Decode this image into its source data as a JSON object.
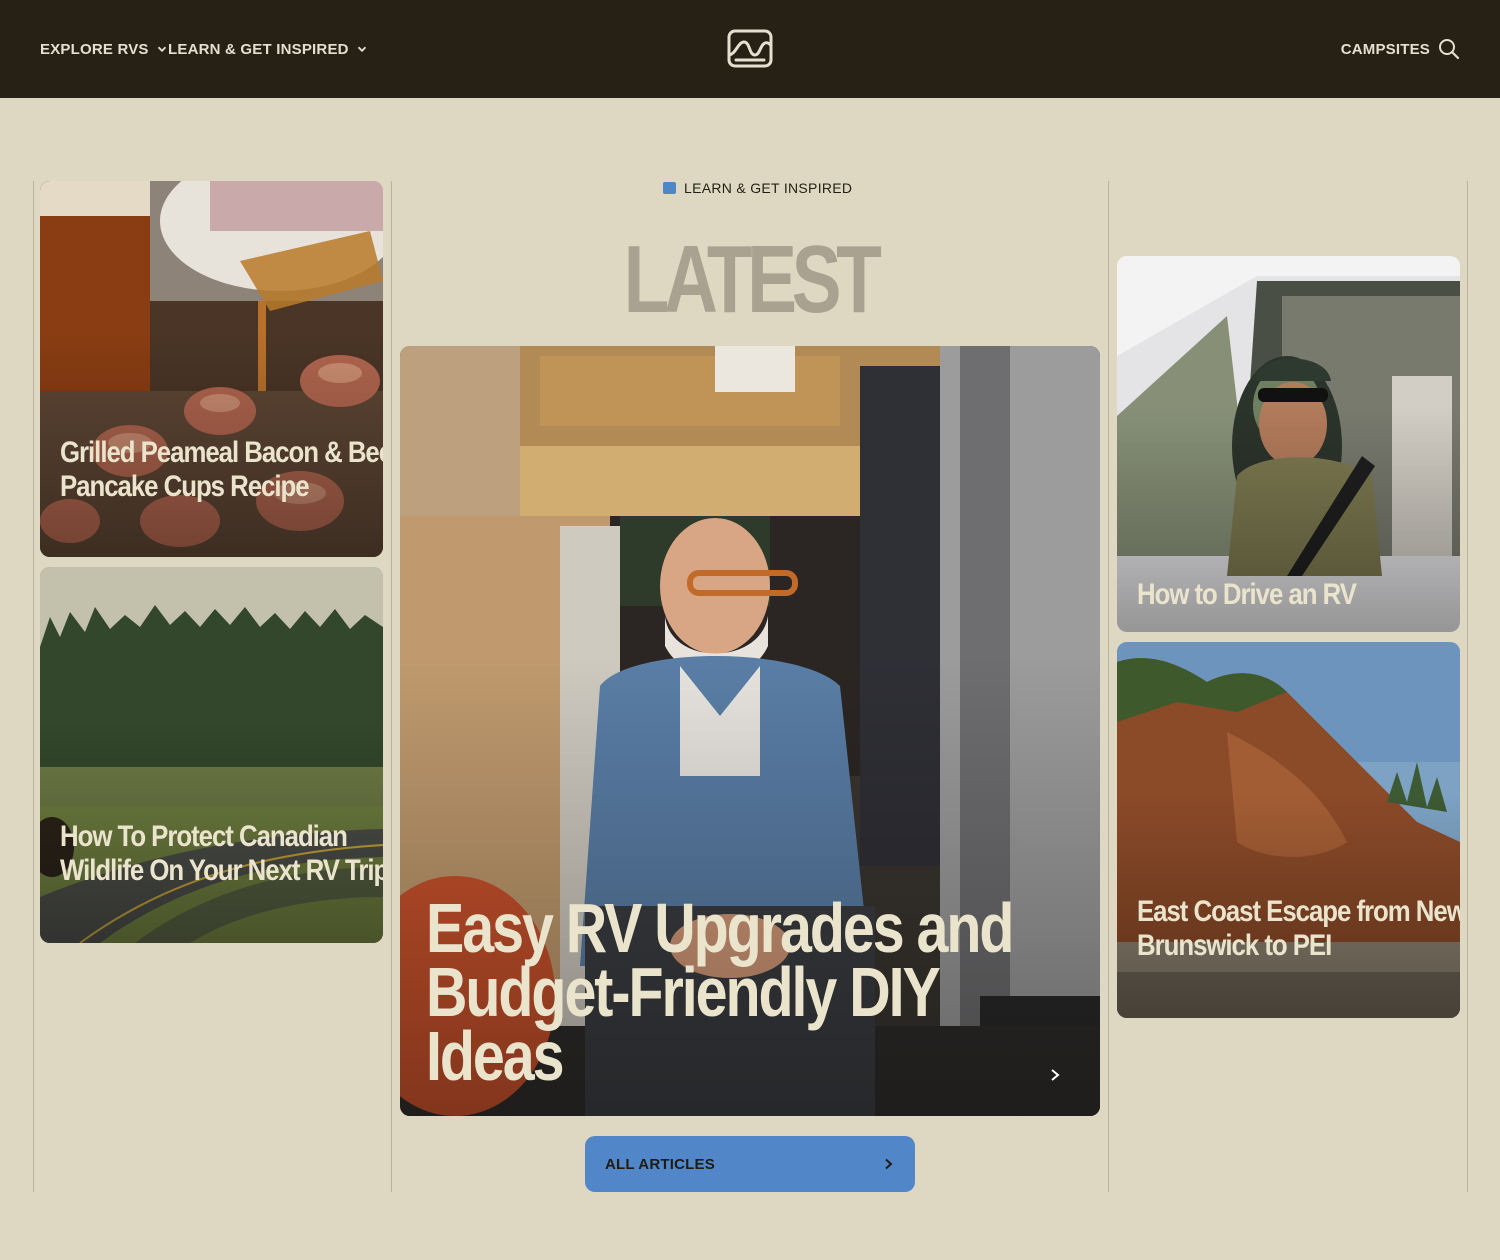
{
  "nav": {
    "explore_label": "EXPLORE RVS",
    "learn_label": "LEARN & GET INSPIRED",
    "campsites_label": "CAMPSITES"
  },
  "section": {
    "eyebrow": "LEARN & GET INSPIRED",
    "title": "LATEST"
  },
  "articles": [
    {
      "title": "Grilled Peameal Bacon & Beer Pancake Cups Recipe"
    },
    {
      "title": "How To Protect Canadian Wildlife On Your Next RV Trip"
    },
    {
      "title": "Easy RV Upgrades and Budget-Friendly DIY Ideas"
    },
    {
      "title": "How to Drive an RV"
    },
    {
      "title": "East Coast Escape from New Brunswick to PEI"
    }
  ],
  "all_articles_label": "ALL ARTICLES",
  "colors": {
    "background": "#ded8c3",
    "nav_background": "#262114",
    "accent_blue": "#5187c9",
    "title_muted": "#a9a290",
    "card_text": "#ebe4cd"
  },
  "icons": [
    "chevron-down-icon",
    "logo-icon",
    "search-icon",
    "chevron-right-icon"
  ]
}
